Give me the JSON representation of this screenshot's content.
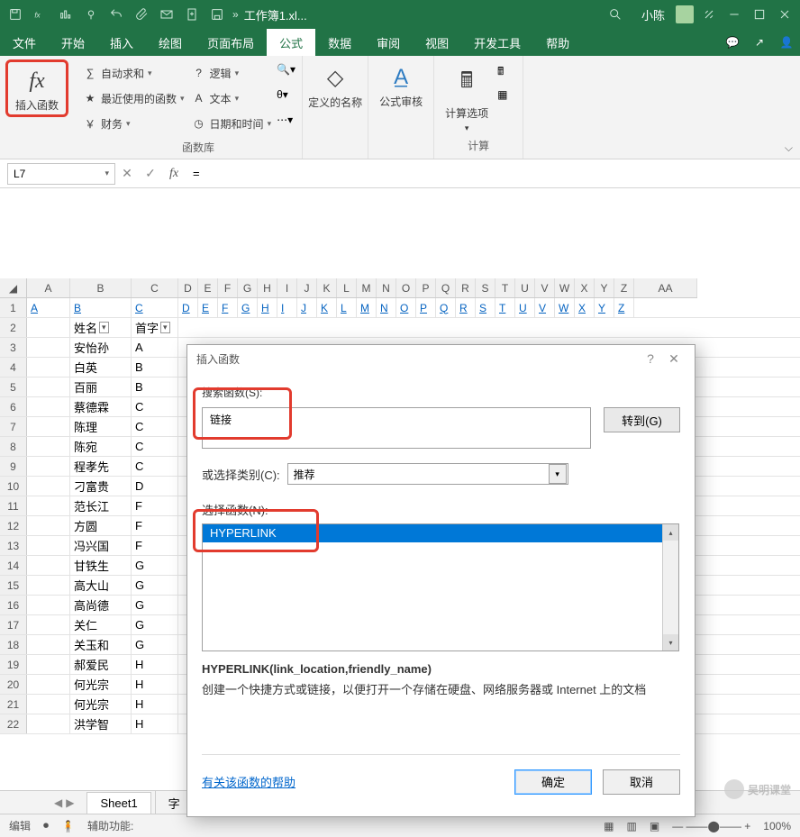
{
  "titlebar": {
    "doc": "工作簿1.xl...",
    "user": "小陈"
  },
  "tabs": [
    "文件",
    "开始",
    "插入",
    "绘图",
    "页面布局",
    "公式",
    "数据",
    "审阅",
    "视图",
    "开发工具",
    "帮助"
  ],
  "active_tab": 5,
  "ribbon": {
    "insert_fn": "插入函数",
    "funclib_label": "函数库",
    "calc_label": "计算",
    "autosum": "自动求和",
    "recent": "最近使用的函数",
    "finance": "财务",
    "logic": "逻辑",
    "text": "文本",
    "datetime": "日期和时间",
    "defname": "定义的名称",
    "audit": "公式审核",
    "calcopt": "计算选项"
  },
  "namebox": "L7",
  "formula": "=",
  "col_letters": [
    "A",
    "B",
    "C",
    "D",
    "E",
    "F",
    "G",
    "H",
    "I",
    "J",
    "K",
    "L",
    "M",
    "N",
    "O",
    "P",
    "Q",
    "R",
    "S",
    "T",
    "U",
    "V",
    "W",
    "X",
    "Y",
    "Z",
    "AA"
  ],
  "row1_links": [
    "A",
    "B",
    "C",
    "D",
    "E",
    "F",
    "G",
    "H",
    "I",
    "J",
    "K",
    "L",
    "M",
    "N",
    "O",
    "P",
    "Q",
    "R",
    "S",
    "T",
    "U",
    "V",
    "W",
    "X",
    "Y",
    "Z"
  ],
  "rows": [
    {
      "n": 2,
      "b": "姓名",
      "c": "首字",
      "filter": true
    },
    {
      "n": 3,
      "b": "安怡孙",
      "c": "A"
    },
    {
      "n": 4,
      "b": "白英",
      "c": "B"
    },
    {
      "n": 5,
      "b": "百丽",
      "c": "B"
    },
    {
      "n": 6,
      "b": "蔡德霖",
      "c": "C"
    },
    {
      "n": 7,
      "b": "陈理",
      "c": "C"
    },
    {
      "n": 8,
      "b": "陈宛",
      "c": "C"
    },
    {
      "n": 9,
      "b": "程孝先",
      "c": "C"
    },
    {
      "n": 10,
      "b": "刁富贵",
      "c": "D"
    },
    {
      "n": 11,
      "b": "范长江",
      "c": "F"
    },
    {
      "n": 12,
      "b": "方圆",
      "c": "F"
    },
    {
      "n": 13,
      "b": "冯兴国",
      "c": "F"
    },
    {
      "n": 14,
      "b": "甘铁生",
      "c": "G"
    },
    {
      "n": 15,
      "b": "高大山",
      "c": "G"
    },
    {
      "n": 16,
      "b": "高尚德",
      "c": "G"
    },
    {
      "n": 17,
      "b": "关仁",
      "c": "G"
    },
    {
      "n": 18,
      "b": "关玉和",
      "c": "G"
    },
    {
      "n": 19,
      "b": "郝爱民",
      "c": "H"
    },
    {
      "n": 20,
      "b": "何光宗",
      "c": "H"
    },
    {
      "n": 21,
      "b": "何光宗",
      "c": "H"
    },
    {
      "n": 22,
      "b": "洪学智",
      "c": "H"
    }
  ],
  "dialog": {
    "title": "插入函数",
    "search_label": "搜索函数(S):",
    "search_value": "链接",
    "goto": "转到(G)",
    "cat_label": "或选择类别(C):",
    "cat_value": "推荐",
    "select_label": "选择函数(N):",
    "selected_fn": "HYPERLINK",
    "syntax": "HYPERLINK(link_location,friendly_name)",
    "desc": "创建一个快捷方式或链接，以便打开一个存储在硬盘、网络服务器或 Internet 上的文档",
    "help": "有关该函数的帮助",
    "ok": "确定",
    "cancel": "取消"
  },
  "sheets": [
    "Sheet1",
    "字"
  ],
  "status": {
    "mode": "编辑",
    "access": "辅助功能:",
    "zoom": "100%"
  },
  "watermark": "吴明课堂"
}
